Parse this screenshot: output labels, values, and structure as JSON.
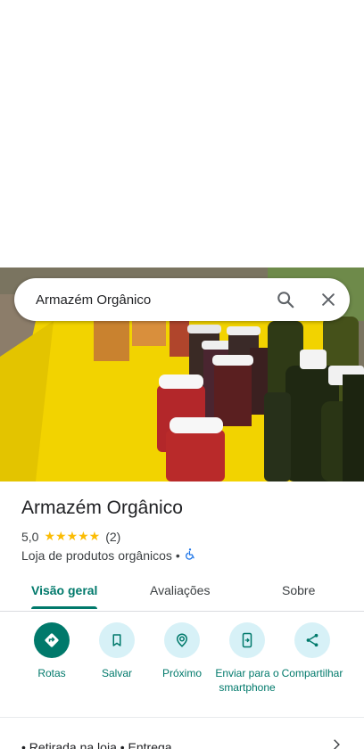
{
  "search": {
    "query": "Armazém Orgânico"
  },
  "place": {
    "name": "Armazém Orgânico",
    "rating": "5,0",
    "stars": "★★★★★",
    "review_count": "(2)",
    "category": "Loja de produtos orgânicos",
    "separator": "•"
  },
  "tabs": [
    {
      "label": "Visão geral",
      "active": true
    },
    {
      "label": "Avaliações",
      "active": false
    },
    {
      "label": "Sobre",
      "active": false
    }
  ],
  "actions": [
    {
      "label": "Rotas",
      "icon": "directions-icon"
    },
    {
      "label": "Salvar",
      "icon": "bookmark-icon"
    },
    {
      "label": "Próximo",
      "icon": "nearby-icon"
    },
    {
      "label": "Enviar para o smartphone",
      "icon": "send-to-phone-icon"
    },
    {
      "label": "Compartilhar",
      "icon": "share-icon"
    }
  ],
  "bottom": {
    "text": "• Retirada na loja • Entrega"
  },
  "colors": {
    "accent": "#00796b",
    "action_bg": "#d7f1f7",
    "star": "#fbbc04"
  }
}
